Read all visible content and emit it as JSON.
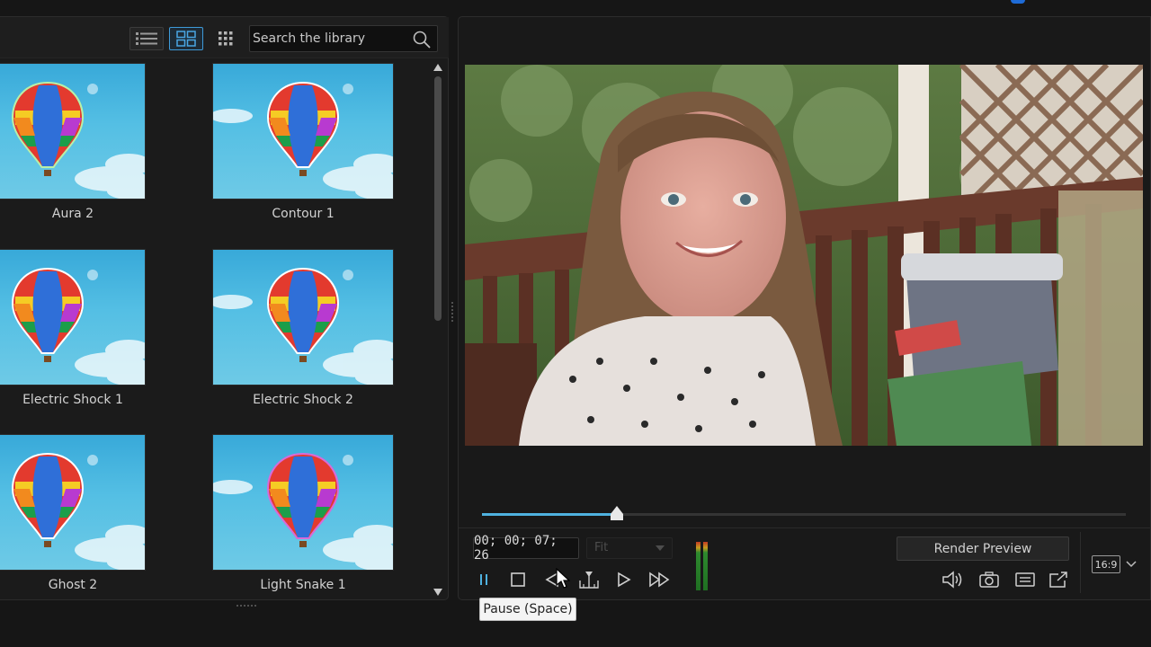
{
  "library": {
    "search": {
      "placeholder": "Search the library",
      "value": ""
    },
    "view_modes": [
      "list-view-icon",
      "grid-view-icon",
      "small-grid-view-icon"
    ],
    "items": [
      {
        "label": "Aura 2"
      },
      {
        "label": "Contour 1"
      },
      {
        "label": "Electric Shock 1"
      },
      {
        "label": "Electric Shock 2"
      },
      {
        "label": "Ghost 2"
      },
      {
        "label": "Light Snake 1"
      }
    ]
  },
  "player": {
    "timecode": "00; 00; 07; 26",
    "fit_label": "Fit",
    "progress": 0.21,
    "render_preview_label": "Render Preview",
    "aspect_ratio": "16:9",
    "tooltip": "Pause (Space)"
  },
  "colors": {
    "accent": "#4fb2e0",
    "panel_bg": "#1b1b1b",
    "sky": "#4ab6e0"
  }
}
